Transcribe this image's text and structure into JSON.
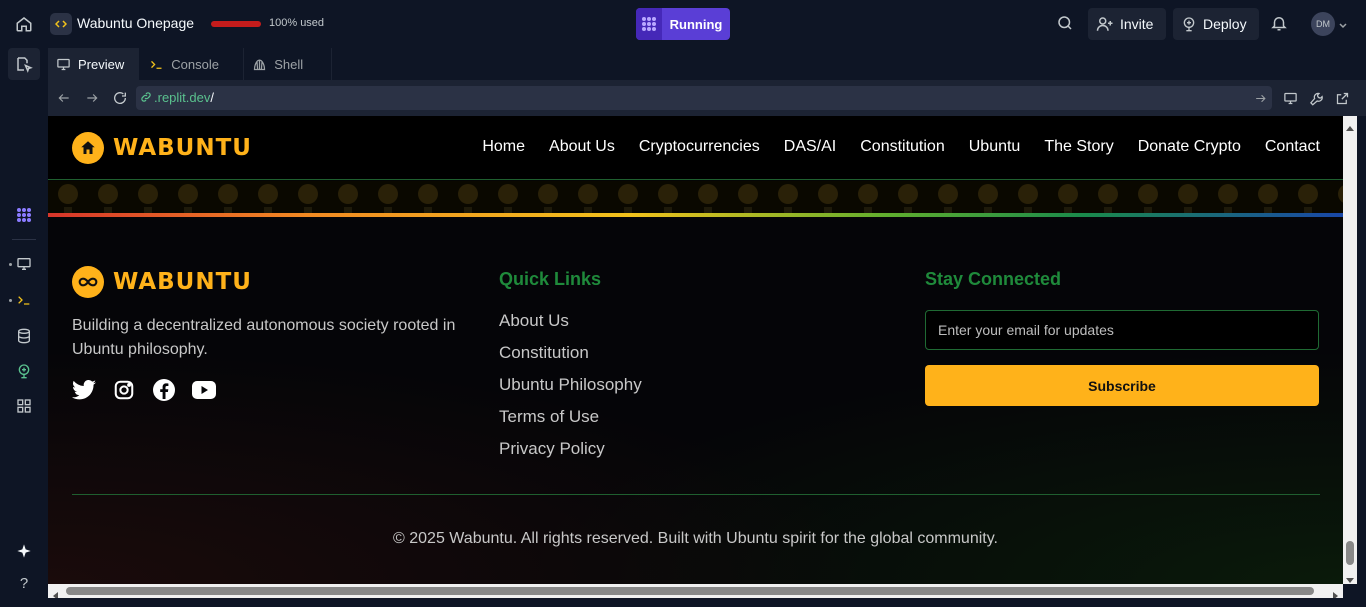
{
  "ide": {
    "project_name": "Wabuntu Onepage",
    "usage_text": "100% used",
    "usage_fraction": 1.0,
    "run_label": "Running",
    "invite_label": "Invite",
    "deploy_label": "Deploy",
    "avatar_initials": "DM"
  },
  "tabs": [
    {
      "label": "Preview",
      "icon": "monitor-icon",
      "active": true
    },
    {
      "label": "Console",
      "icon": "terminal-icon",
      "active": false
    },
    {
      "label": "Shell",
      "icon": "shell-icon",
      "active": false
    }
  ],
  "urlbar": {
    "host": ".replit.dev",
    "path": "/"
  },
  "site": {
    "logo_text": "WABUNTU",
    "nav": [
      "Home",
      "About Us",
      "Cryptocurrencies",
      "DAS/AI",
      "Constitution",
      "Ubuntu",
      "The Story",
      "Donate Crypto",
      "Contact"
    ],
    "footer": {
      "logo_text": "WABUNTU",
      "description": "Building a decentralized autonomous society rooted in Ubuntu philosophy.",
      "socials": [
        "twitter-icon",
        "instagram-icon",
        "facebook-icon",
        "youtube-icon"
      ],
      "quick_links_heading": "Quick Links",
      "quick_links": [
        "About Us",
        "Constitution",
        "Ubuntu Philosophy",
        "Terms of Use",
        "Privacy Policy"
      ],
      "stay_connected_heading": "Stay Connected",
      "email_placeholder": "Enter your email for updates",
      "subscribe_label": "Subscribe",
      "copyright": "© 2025 Wabuntu. All rights reserved. Built with Ubuntu spirit for the global community."
    }
  },
  "colors": {
    "brand": "#ffb21a",
    "heading_green": "#1f8a3b",
    "run_purple": "#5a3ed6",
    "usage_red": "#c51c1c"
  }
}
